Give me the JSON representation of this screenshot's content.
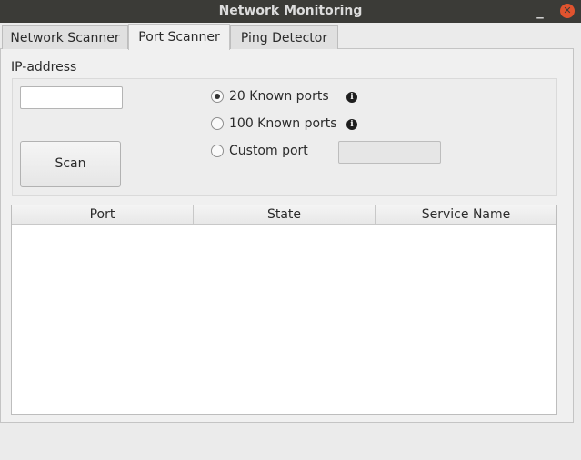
{
  "window": {
    "title": "Network Monitoring",
    "minimize_glyph": "_",
    "close_glyph": "✕"
  },
  "tabs": [
    {
      "label": "Network Scanner",
      "active": false
    },
    {
      "label": "Port Scanner",
      "active": true
    },
    {
      "label": "Ping Detector",
      "active": false
    }
  ],
  "port_scanner": {
    "ip_label": "IP-address",
    "ip_value": "",
    "scan_label": "Scan",
    "options": [
      {
        "label": "20 Known ports",
        "checked": true,
        "info_icon": "info-icon"
      },
      {
        "label": "100 Known ports",
        "checked": false,
        "info_icon": "info-icon"
      },
      {
        "label": "Custom port",
        "checked": false
      }
    ],
    "custom_port_value": ""
  },
  "results_table": {
    "columns": [
      "Port",
      "State",
      "Service Name"
    ],
    "rows": []
  },
  "colors": {
    "titlebar": "#3b3b37",
    "close_button": "#e0532e",
    "window_bg": "#ebebeb"
  }
}
